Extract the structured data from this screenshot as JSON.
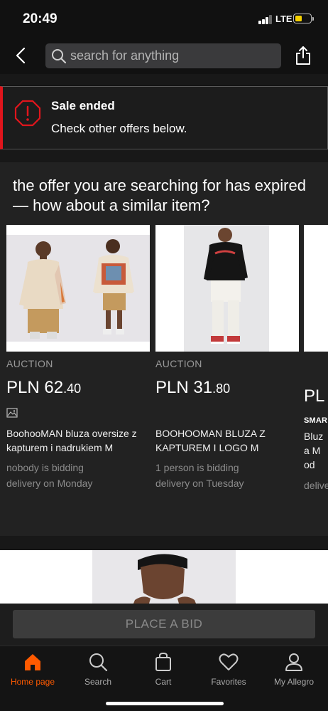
{
  "status": {
    "time": "20:49",
    "network": "LTE",
    "battery_level": 0.45
  },
  "search": {
    "placeholder": "search for anything"
  },
  "banner": {
    "title": "Sale ended",
    "text": "Check other offers below."
  },
  "similar": {
    "heading": "the offer you are searching for has expired — how about a similar item?",
    "cards": [
      {
        "type": "AUCTION",
        "price_main": "PLN 62",
        "price_cents": ".40",
        "title": "BoohooMAN bluza oversize z kapturem i nadrukiem M",
        "bidding": "nobody is bidding",
        "delivery": "delivery on Monday"
      },
      {
        "type": "AUCTION",
        "price_main": "PLN 31",
        "price_cents": ".80",
        "title": "BOOHOOMAN BLUZA Z KAPTUREM I LOGO M",
        "bidding": "1 person is bidding",
        "delivery": "delivery on Tuesday"
      },
      {
        "price_main": "PL",
        "badge": "SMAR",
        "title": "Bluza M od",
        "delivery": "delive"
      }
    ]
  },
  "bid_button": {
    "label": "PLACE A BID"
  },
  "tabs": [
    {
      "label": "Home page",
      "icon": "home-icon",
      "active": true
    },
    {
      "label": "Search",
      "icon": "search-icon",
      "active": false
    },
    {
      "label": "Cart",
      "icon": "cart-icon",
      "active": false
    },
    {
      "label": "Favorites",
      "icon": "heart-icon",
      "active": false
    },
    {
      "label": "My Allegro",
      "icon": "user-icon",
      "active": false
    }
  ],
  "colors": {
    "accent": "#ff5a00",
    "alert_red": "#e0151c",
    "battery": "#f5d100"
  }
}
